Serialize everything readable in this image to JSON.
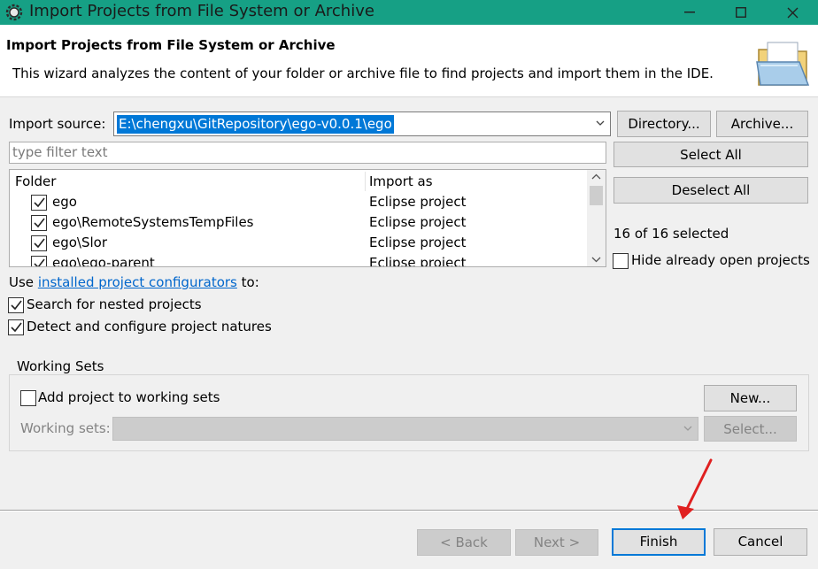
{
  "window": {
    "title": "Import Projects from File System or Archive"
  },
  "header": {
    "title": "Import Projects from File System or Archive",
    "description": "This wizard analyzes the content of your folder or archive file to find projects and import them in the IDE."
  },
  "import_source": {
    "label": "Import source:",
    "value": "E:\\chengxu\\GitRepository\\ego-v0.0.1\\ego",
    "directory_button": "Directory...",
    "archive_button": "Archive..."
  },
  "filter": {
    "placeholder": "type filter text"
  },
  "table": {
    "columns": [
      "Folder",
      "Import as"
    ],
    "rows": [
      {
        "folder": "ego",
        "import_as": "Eclipse project",
        "checked": true
      },
      {
        "folder": "ego\\RemoteSystemsTempFiles",
        "import_as": "Eclipse project",
        "checked": true
      },
      {
        "folder": "ego\\Slor",
        "import_as": "Eclipse project",
        "checked": true
      },
      {
        "folder": "ego\\ego-parent",
        "import_as": "Eclipse project",
        "checked": true
      }
    ]
  },
  "side": {
    "select_all": "Select All",
    "deselect_all": "Deselect All",
    "selected_count": "16 of 16 selected",
    "hide_open": {
      "label": "Hide already open projects",
      "checked": false
    }
  },
  "options": {
    "use_prefix": "Use",
    "configurators_link": "installed project configurators",
    "use_suffix": "to:",
    "search_nested": {
      "label": "Search for nested projects",
      "checked": true
    },
    "detect_natures": {
      "label": "Detect and configure project natures",
      "checked": true
    }
  },
  "working_sets": {
    "title": "Working Sets",
    "add_to_sets": {
      "label": "Add project to working sets",
      "checked": false
    },
    "new_button": "New...",
    "sets_label": "Working sets:",
    "sets_value": "",
    "select_button": "Select..."
  },
  "footer": {
    "back": "< Back",
    "next": "Next >",
    "finish": "Finish",
    "cancel": "Cancel"
  },
  "colors": {
    "titlebar": "#16a085",
    "selection": "#0078d7",
    "link": "#0066cc",
    "annotation_arrow": "#e02020"
  }
}
